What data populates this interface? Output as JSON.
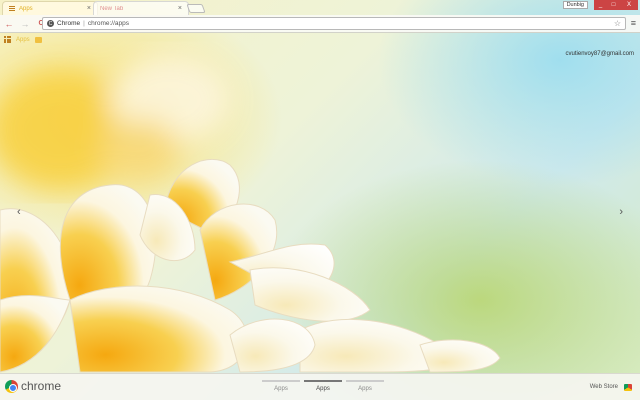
{
  "tabs": [
    {
      "label": "Apps",
      "active": true
    },
    {
      "label": "New Tab",
      "active": false
    }
  ],
  "window": {
    "user": "Dunbig",
    "min": "_",
    "max": "□",
    "close": "X"
  },
  "toolbar": {
    "back": "←",
    "forward": "→",
    "reload": "C",
    "site_label": "Chrome",
    "url": "chrome://apps",
    "star": "☆",
    "menu": "≡"
  },
  "bookmarks": {
    "apps_label": "Apps",
    "folder_label": ""
  },
  "account": {
    "email": "cvutienvoy87@gmail.com"
  },
  "nav": {
    "prev": "‹",
    "next": "›"
  },
  "bottom": {
    "brand": "chrome",
    "pages": [
      {
        "label": "Apps",
        "current": false
      },
      {
        "label": "Apps",
        "current": true
      },
      {
        "label": "Apps",
        "current": false
      }
    ],
    "webstore": "Web Store"
  },
  "colors": {
    "accent_red": "#cc4444",
    "flower_yellow": "#f5b820",
    "petal_white": "#fbfaf0"
  }
}
